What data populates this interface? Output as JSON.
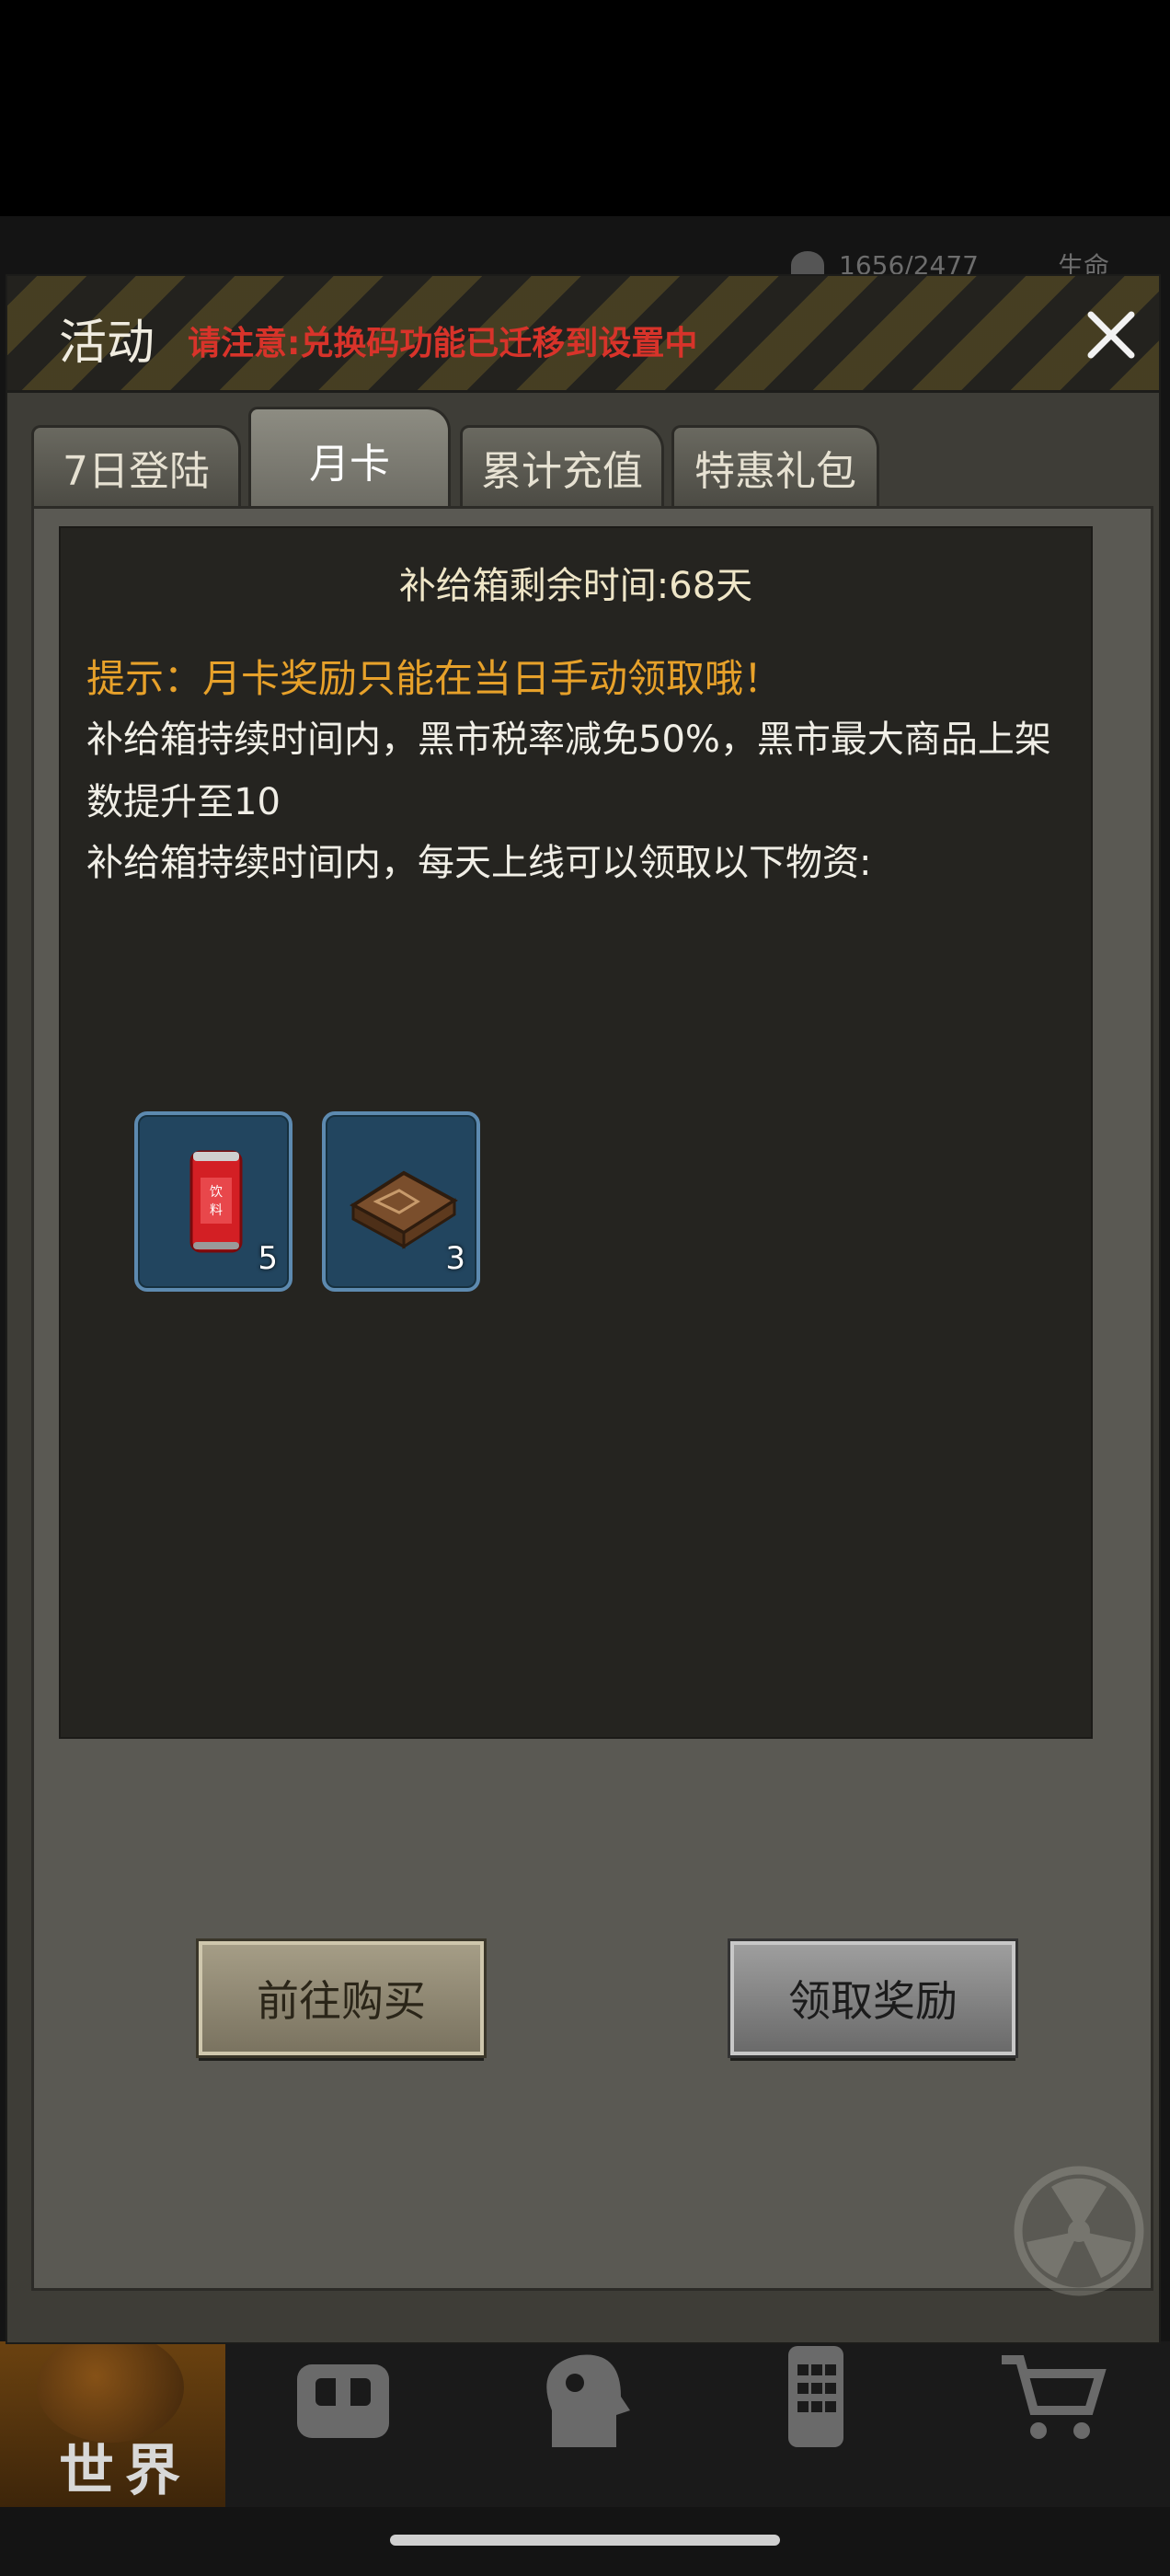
{
  "background": {
    "status": {
      "energy_value": "1656/2477",
      "life_label": "生命"
    },
    "bottom_nav": [
      {
        "label": "世界",
        "icon": "globe-icon",
        "active": true
      },
      {
        "label": "",
        "icon": "backpack-icon",
        "active": false
      },
      {
        "label": "",
        "icon": "head-profile-icon",
        "active": false
      },
      {
        "label": "",
        "icon": "phone-keypad-icon",
        "active": false
      },
      {
        "label": "",
        "icon": "shopping-cart-icon",
        "active": false
      }
    ]
  },
  "dialog": {
    "title": "活动",
    "notice": "请注意:兑换码功能已迁移到设置中",
    "close_icon": "close-icon",
    "tabs": [
      {
        "label": "7日登陆",
        "active": false
      },
      {
        "label": "月卡",
        "active": true
      },
      {
        "label": "累计充值",
        "active": false
      },
      {
        "label": "特惠礼包",
        "active": false
      }
    ],
    "content": {
      "remaining_time": "补给箱剩余时间:68天",
      "tip": "提示：月卡奖励只能在当日手动领取哦！",
      "description_1": "补给箱持续时间内，黑市税率减免50%，黑市最大商品上架数提升至10",
      "description_2": "补给箱持续时间内，每天上线可以领取以下物资:",
      "rewards": [
        {
          "icon": "drink-can-icon",
          "can_label": "饮料",
          "quantity": "5"
        },
        {
          "icon": "map-box-icon",
          "quantity": "3"
        }
      ]
    },
    "buttons": {
      "buy_label": "前往购买",
      "claim_label": "领取奖励"
    },
    "colors": {
      "notice": "#d8332a",
      "tip": "#e7a12a",
      "reward_border": "#5d8ab0"
    }
  }
}
